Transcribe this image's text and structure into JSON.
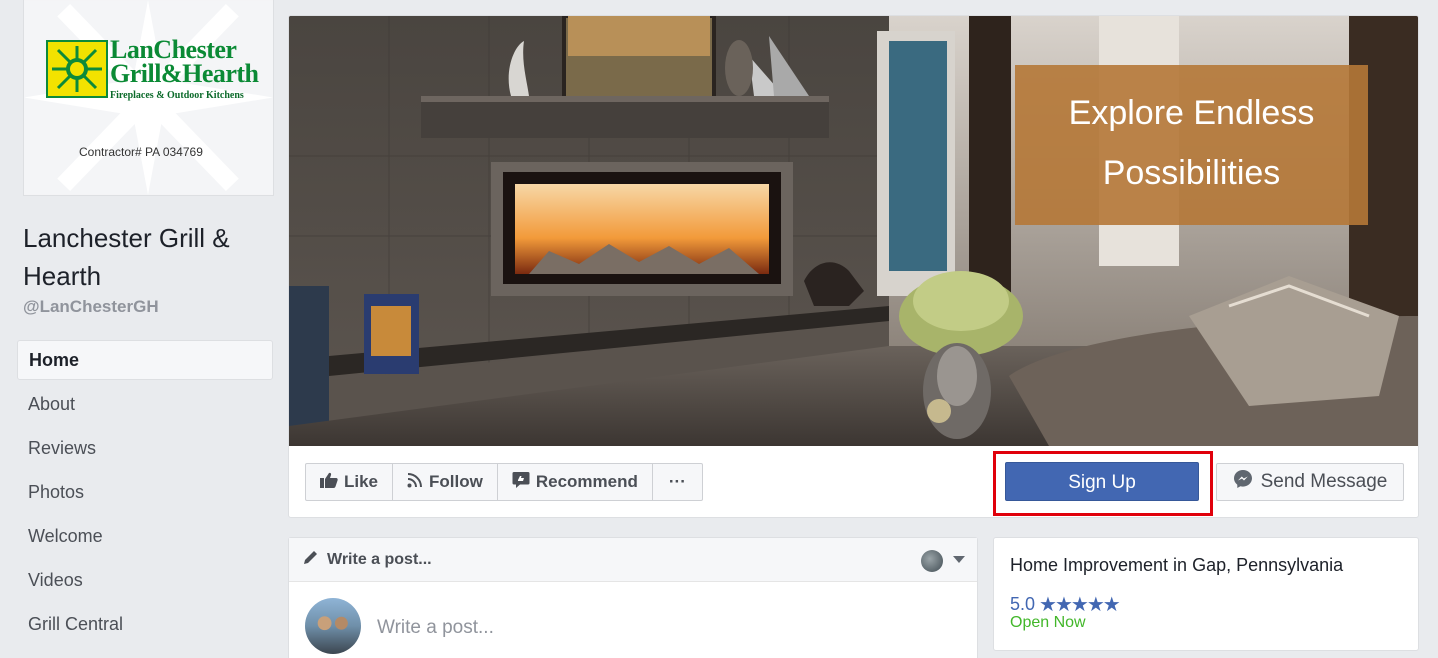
{
  "profile": {
    "logo_line1": "LanChester",
    "logo_line2": "Grill&Hearth",
    "logo_tagline": "Fireplaces & Outdoor Kitchens",
    "contractor": "Contractor# PA 034769",
    "name": "Lanchester Grill & Hearth",
    "handle": "@LanChesterGH"
  },
  "nav": {
    "items": [
      {
        "label": "Home",
        "active": true
      },
      {
        "label": "About"
      },
      {
        "label": "Reviews"
      },
      {
        "label": "Photos"
      },
      {
        "label": "Welcome"
      },
      {
        "label": "Videos"
      },
      {
        "label": "Grill Central"
      }
    ]
  },
  "cover": {
    "promo_line1": "Explore Endless",
    "promo_line2": "Possibilities"
  },
  "actions": {
    "like": "Like",
    "follow": "Follow",
    "recommend": "Recommend",
    "more": "···",
    "signup": "Sign Up",
    "send_message": "Send Message"
  },
  "composer": {
    "header": "Write a post...",
    "placeholder": "Write a post..."
  },
  "about": {
    "category": "Home Improvement in Gap, Pennsylvania",
    "rating": "5.0",
    "stars": "★★★★★",
    "open_status": "Open Now"
  },
  "colors": {
    "brand_blue": "#4267b2",
    "highlight_red": "#e0000b",
    "open_green": "#42b72a",
    "promo_brown": "#b57837"
  }
}
